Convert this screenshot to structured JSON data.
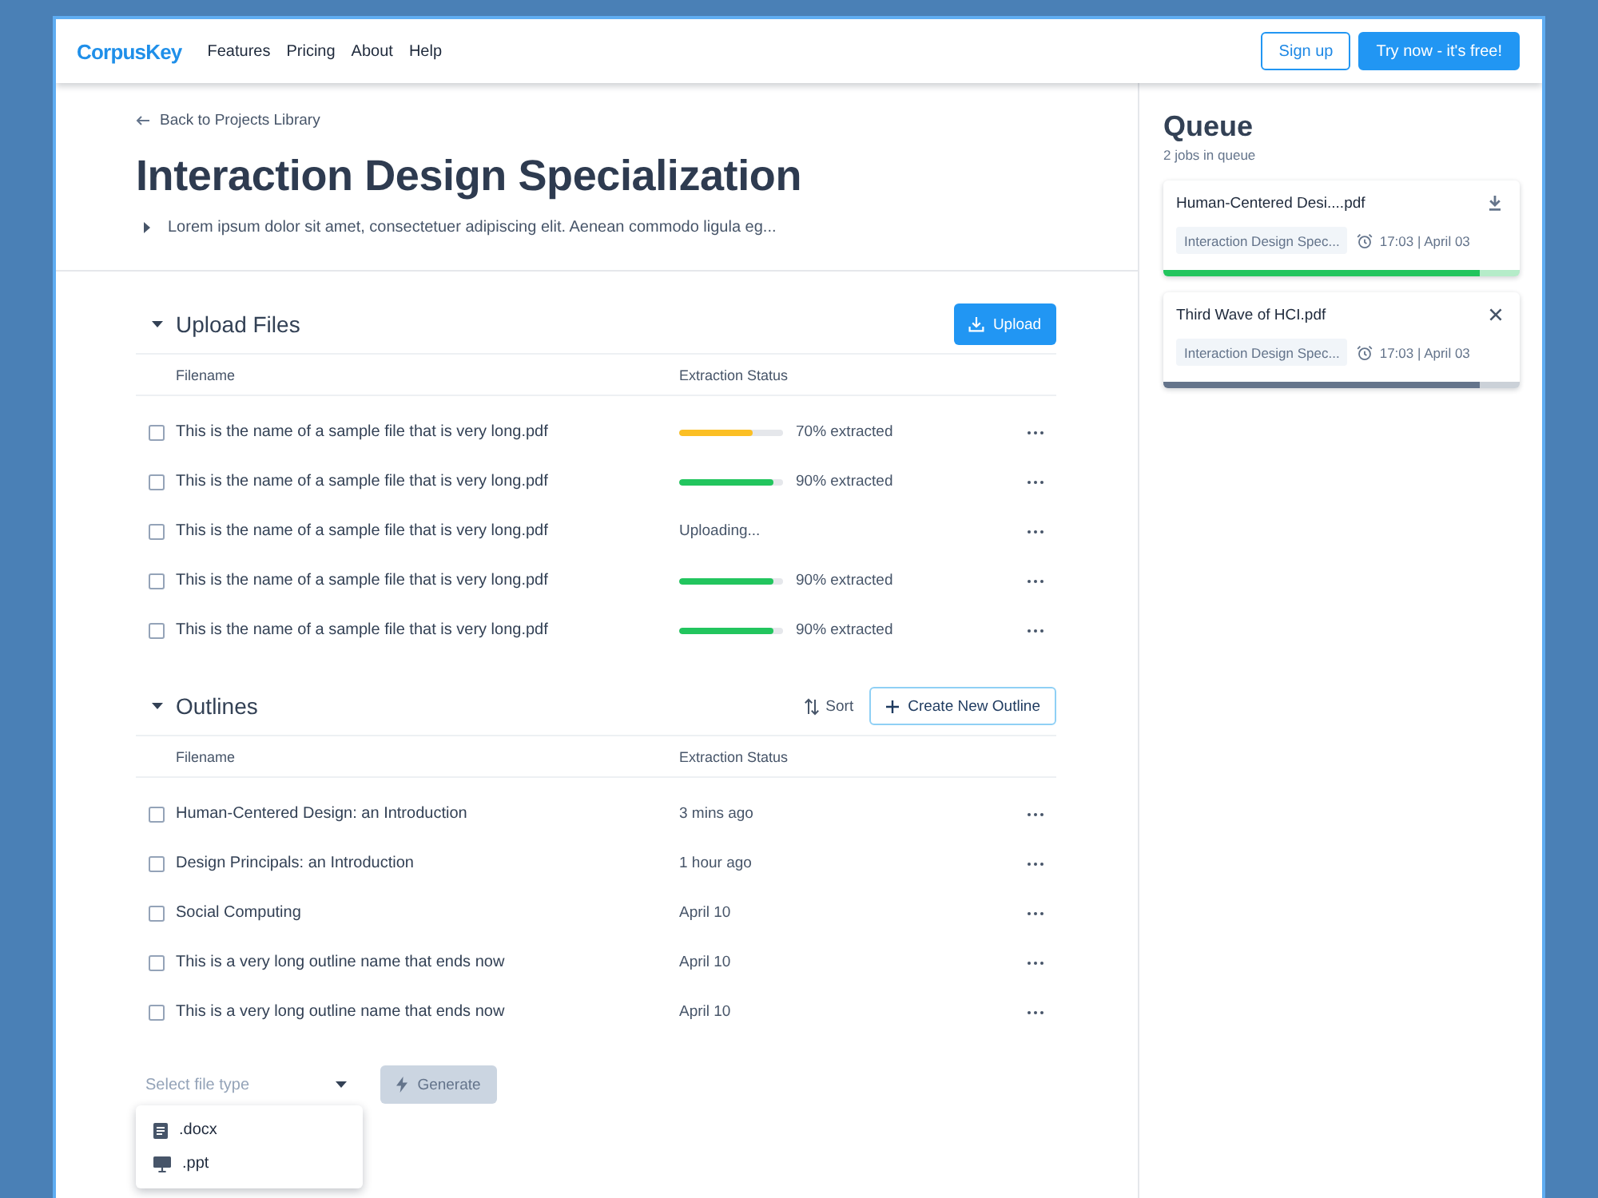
{
  "nav": {
    "logo": "CorpusKey",
    "links": [
      "Features",
      "Pricing",
      "About",
      "Help"
    ],
    "buttons": [
      {
        "label": "Sign up",
        "kind": "outline"
      },
      {
        "label": "Try now - it's free!",
        "kind": "primary"
      }
    ]
  },
  "project": {
    "back_link": "Back to Projects Library",
    "title": "Interaction Design Specialization",
    "description": "Lorem ipsum dolor sit amet, consectetuer adipiscing elit. Aenean commodo ligula eg...",
    "description_expanded": false
  },
  "upload_files": {
    "title": "Upload Files",
    "expanded": true,
    "button": "Upload",
    "columns": [
      "Filename",
      "Extraction Status"
    ],
    "rows": [
      {
        "filename": "This is the name of a sample file that is very long.pdf",
        "checked": false,
        "status": {
          "kind": "progress",
          "level": 0.7,
          "color": "#fbbf24",
          "reading": "70% extracted"
        }
      },
      {
        "filename": "This is the name of a sample file that is very long.pdf",
        "checked": false,
        "status": {
          "kind": "progress",
          "level": 0.9,
          "color": "#22c55e",
          "reading": "90% extracted"
        }
      },
      {
        "filename": "This is the name of a sample file that is very long.pdf",
        "checked": false,
        "status": {
          "kind": "text",
          "reading": "Uploading..."
        }
      },
      {
        "filename": "This is the name of a sample file that is very long.pdf",
        "checked": false,
        "status": {
          "kind": "progress",
          "level": 0.9,
          "color": "#22c55e",
          "reading": "90% extracted"
        }
      },
      {
        "filename": "This is the name of a sample file that is very long.pdf",
        "checked": false,
        "status": {
          "kind": "progress",
          "level": 0.9,
          "color": "#22c55e",
          "reading": "90% extracted"
        }
      }
    ]
  },
  "outlines": {
    "title": "Outlines",
    "expanded": true,
    "sort_button": "Sort",
    "create_button": "Create New Outline",
    "columns": [
      "Filename",
      "Extraction Status"
    ],
    "rows": [
      {
        "name": "Human-Centered Design: an Introduction",
        "checked": false,
        "updated": "3 mins ago"
      },
      {
        "name": "Design Principals: an Introduction",
        "checked": false,
        "updated": "1 hour ago"
      },
      {
        "name": "Social Computing",
        "checked": false,
        "updated": "April 10"
      },
      {
        "name": "This is a very long outline name that ends now",
        "checked": false,
        "updated": "April 10"
      },
      {
        "name": "This is a very long outline name that ends now",
        "checked": false,
        "updated": "April 10"
      }
    ]
  },
  "generate": {
    "select": {
      "placeholder": "Select file type",
      "open": true,
      "options": [
        {
          "label": ".docx",
          "kind": "document"
        },
        {
          "label": ".ppt",
          "kind": "presentation"
        }
      ]
    },
    "button": {
      "label": "Generate",
      "disabled": true
    }
  },
  "queue": {
    "title": "Queue",
    "count": "2 jobs in queue",
    "jobs": [
      {
        "filename": "Human-Centered Desi....pdf",
        "kind": "download",
        "tag": "Interaction Design Spec...",
        "time": "17:03 | April 03",
        "level": 0.89,
        "color": "#22c55e"
      },
      {
        "filename": "Third Wave of HCI.pdf",
        "kind": "cancel",
        "tag": "Interaction Design Spec...",
        "time": "17:03 | April 03",
        "level": 0.89,
        "color": "#64748b"
      }
    ]
  }
}
